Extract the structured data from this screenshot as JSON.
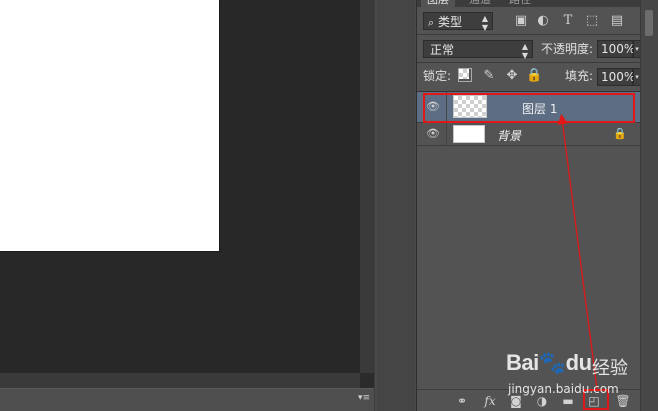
{
  "tabs": [
    "图层",
    "通道",
    "路径"
  ],
  "filter": {
    "kind_label": "类型",
    "search_icon": "search-icon"
  },
  "filter_icons": [
    "image-filter-icon",
    "adjustment-filter-icon",
    "type-filter-icon",
    "shape-filter-icon",
    "smart-object-filter-icon"
  ],
  "blend": {
    "mode": "正常",
    "opacity_label": "不透明度:",
    "opacity_value": "100%"
  },
  "lock": {
    "label": "锁定:",
    "fill_label": "填充:",
    "fill_value": "100%"
  },
  "layers": [
    {
      "name": "图层 1",
      "selected": true,
      "transparent": true,
      "locked": false
    },
    {
      "name": "背景",
      "selected": false,
      "transparent": false,
      "locked": true
    }
  ],
  "bottom_icons": [
    "link-layers-icon",
    "fx-icon",
    "add-mask-icon",
    "adjustment-layer-icon",
    "new-group-icon",
    "new-layer-icon",
    "delete-layer-icon"
  ],
  "bottom_fx_label": "fx",
  "colors": {
    "highlight": "#e01818",
    "selected_row": "#5d6d83",
    "panel_bg": "#535353"
  },
  "watermark": {
    "logo": "Bai",
    "logo_tail": "du",
    "name": "经验",
    "url": "jingyan.baidu.com"
  }
}
